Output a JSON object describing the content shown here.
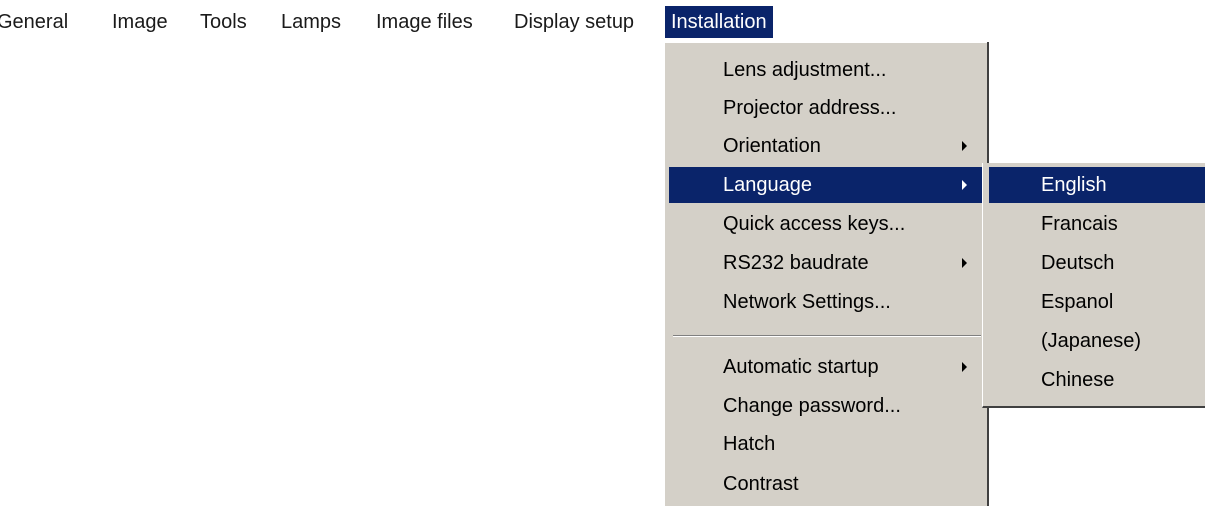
{
  "menubar": {
    "items": [
      {
        "label": "General"
      },
      {
        "label": "Image"
      },
      {
        "label": "Tools"
      },
      {
        "label": "Lamps"
      },
      {
        "label": "Image files"
      },
      {
        "label": "Display setup"
      },
      {
        "label": "Installation",
        "active": true
      }
    ]
  },
  "installation_menu": {
    "items": [
      {
        "label": "Lens adjustment..."
      },
      {
        "label": "Projector address..."
      },
      {
        "label": "Orientation",
        "submenu": true
      },
      {
        "label": "Language",
        "submenu": true,
        "selected": true
      },
      {
        "label": "Quick access keys..."
      },
      {
        "label": "RS232 baudrate",
        "submenu": true
      },
      {
        "label": "Network Settings..."
      },
      {
        "label": "Automatic startup",
        "submenu": true
      },
      {
        "label": "Change password..."
      },
      {
        "label": "Hatch"
      },
      {
        "label": "Contrast"
      }
    ]
  },
  "language_submenu": {
    "items": [
      {
        "label": "English",
        "selected": true
      },
      {
        "label": "Francais"
      },
      {
        "label": "Deutsch"
      },
      {
        "label": "Espanol"
      },
      {
        "label": "(Japanese)"
      },
      {
        "label": "Chinese"
      }
    ]
  },
  "colors": {
    "highlight": "#0a246a",
    "menu_background": "#d4d0c8"
  }
}
